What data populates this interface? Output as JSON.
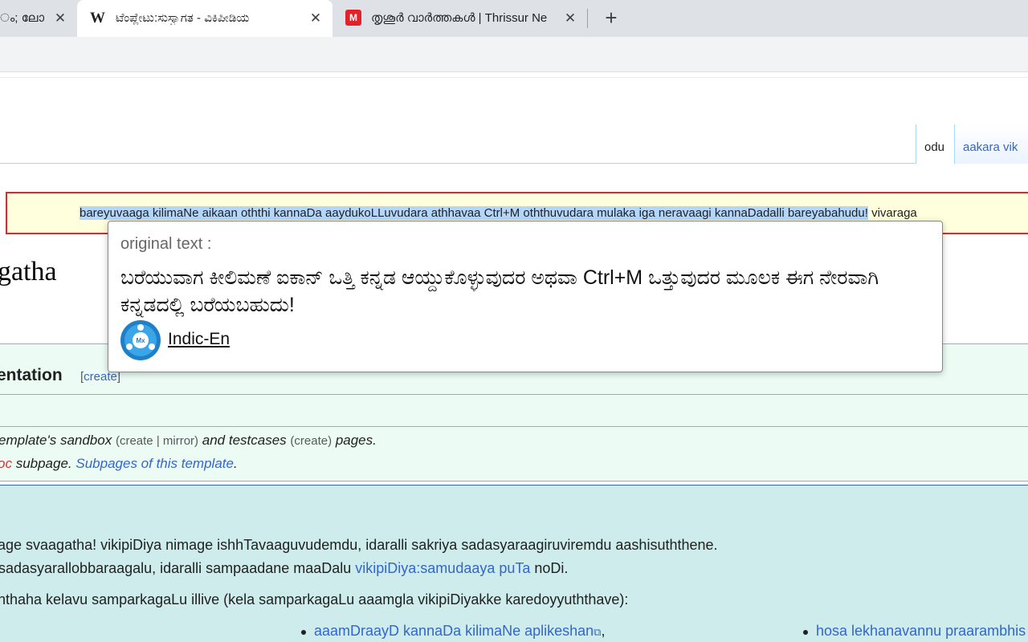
{
  "browser": {
    "tabs": [
      {
        "title": "ം; ലോക",
        "active": false
      },
      {
        "title": "ಟೆಂಪ್ಲೇಟು:ಸುಸ್ವಾಗತ - ವಿಕಿಪೀಡಿಯ",
        "active": true,
        "favicon": "W"
      },
      {
        "title": "തൃശൂർ വാർത്തകൾ | Thrissur Ne",
        "active": false,
        "favicon": "M"
      }
    ],
    "close_glyph": "✕",
    "new_tab_glyph": "+"
  },
  "page": {
    "content_tabs": {
      "read": "odu",
      "edit": "aakara vik"
    },
    "notice": {
      "selected_text": "bareyuvaaga kilimaNe aikaan oththi kannaDa aaydukoLLuvudara athhavaa Ctrl+M oththuvudara mulaka iga neravaagi kannaDadalli bareyabahudu!",
      "trailing_text": " vivaraga"
    },
    "heading": "gatha",
    "documentation": {
      "heading": "entation",
      "edit_open": "[",
      "edit_link": "create",
      "edit_close": "]",
      "line1": {
        "t1": "emplate's sandbox ",
        "p1": "(",
        "create1": "create",
        "bar": " | ",
        "mirror": "mirror",
        "p2": ")",
        "t2": " and testcases ",
        "p3": "(",
        "create2": "create",
        "p4": ")",
        "t3": " pages."
      },
      "line2": {
        "redlink": "oc",
        "t1": " subpage. ",
        "link": "Subpages of this template",
        "t2": "."
      }
    },
    "welcome": {
      "line1": "age svaagatha! vikipiDiya nimage ishhTavaaguvudemdu, idaralli sakriya sadasyaraagiruviremdu aashisuththene.",
      "line2_text": "sadasyarallobbaraagalu, idaralli sampaadane maaDalu ",
      "line2_link": "vikipiDiya:samudaaya puTa",
      "line2_end": " noDi.",
      "line3": "nthaha kelavu samparkagaLu illive (kela samparkagaLu aaamgla vikipiDiyakke karedoyyuththave):",
      "bullet1_link": "aaamDraayD kannaDa kilimaNe aplikeshan",
      "bullet1_end": ",",
      "bullet2_link": "hosa lekhanavannu praarambhis"
    }
  },
  "popup": {
    "label": "original text :",
    "text": "ಬರೆಯುವಾಗ ಕೀಲಿಮಣೆ ಐಕಾನ್ ಒತ್ತಿ ಕನ್ನಡ ಆಯ್ದುಕೊಳ್ಳುವುದರ ಅಥವಾ Ctrl+M ಒತ್ತುವುದರ ಮೂಲಕ ಈಗ ನೇರವಾಗಿ ಕನ್ನಡದಲ್ಲಿ ಬರೆಯಬಹುದು!",
    "brand": "Indic-En",
    "logo_text": "Mx"
  }
}
